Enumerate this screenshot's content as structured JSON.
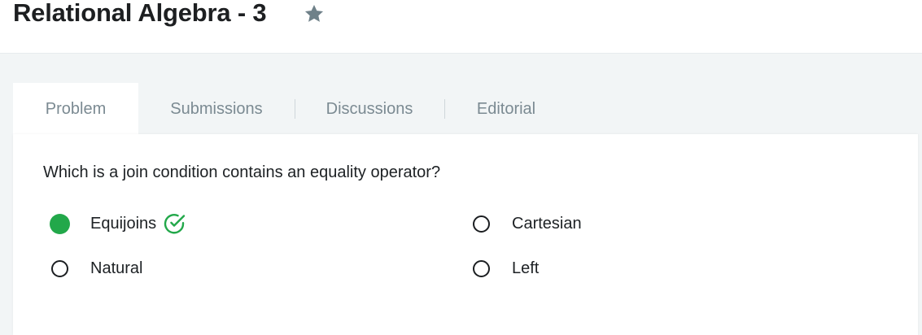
{
  "header": {
    "title": "Relational Algebra - 3"
  },
  "tabs": [
    {
      "label": "Problem",
      "active": true
    },
    {
      "label": "Submissions",
      "active": false
    },
    {
      "label": "Discussions",
      "active": false
    },
    {
      "label": "Editorial",
      "active": false
    }
  ],
  "problem": {
    "question": "Which is a join condition contains an equality operator?",
    "options": [
      {
        "label": "Equijoins",
        "selected": true,
        "correct": true
      },
      {
        "label": "Cartesian",
        "selected": false,
        "correct": false
      },
      {
        "label": "Natural",
        "selected": false,
        "correct": false
      },
      {
        "label": "Left",
        "selected": false,
        "correct": false
      }
    ]
  },
  "colors": {
    "selected_green": "#22a84a",
    "star_gray": "#6f8189",
    "tab_text": "#7b8a92",
    "background": "#f2f5f6"
  },
  "icons": {
    "favorite": "star-icon",
    "correct": "check-circle-icon"
  }
}
